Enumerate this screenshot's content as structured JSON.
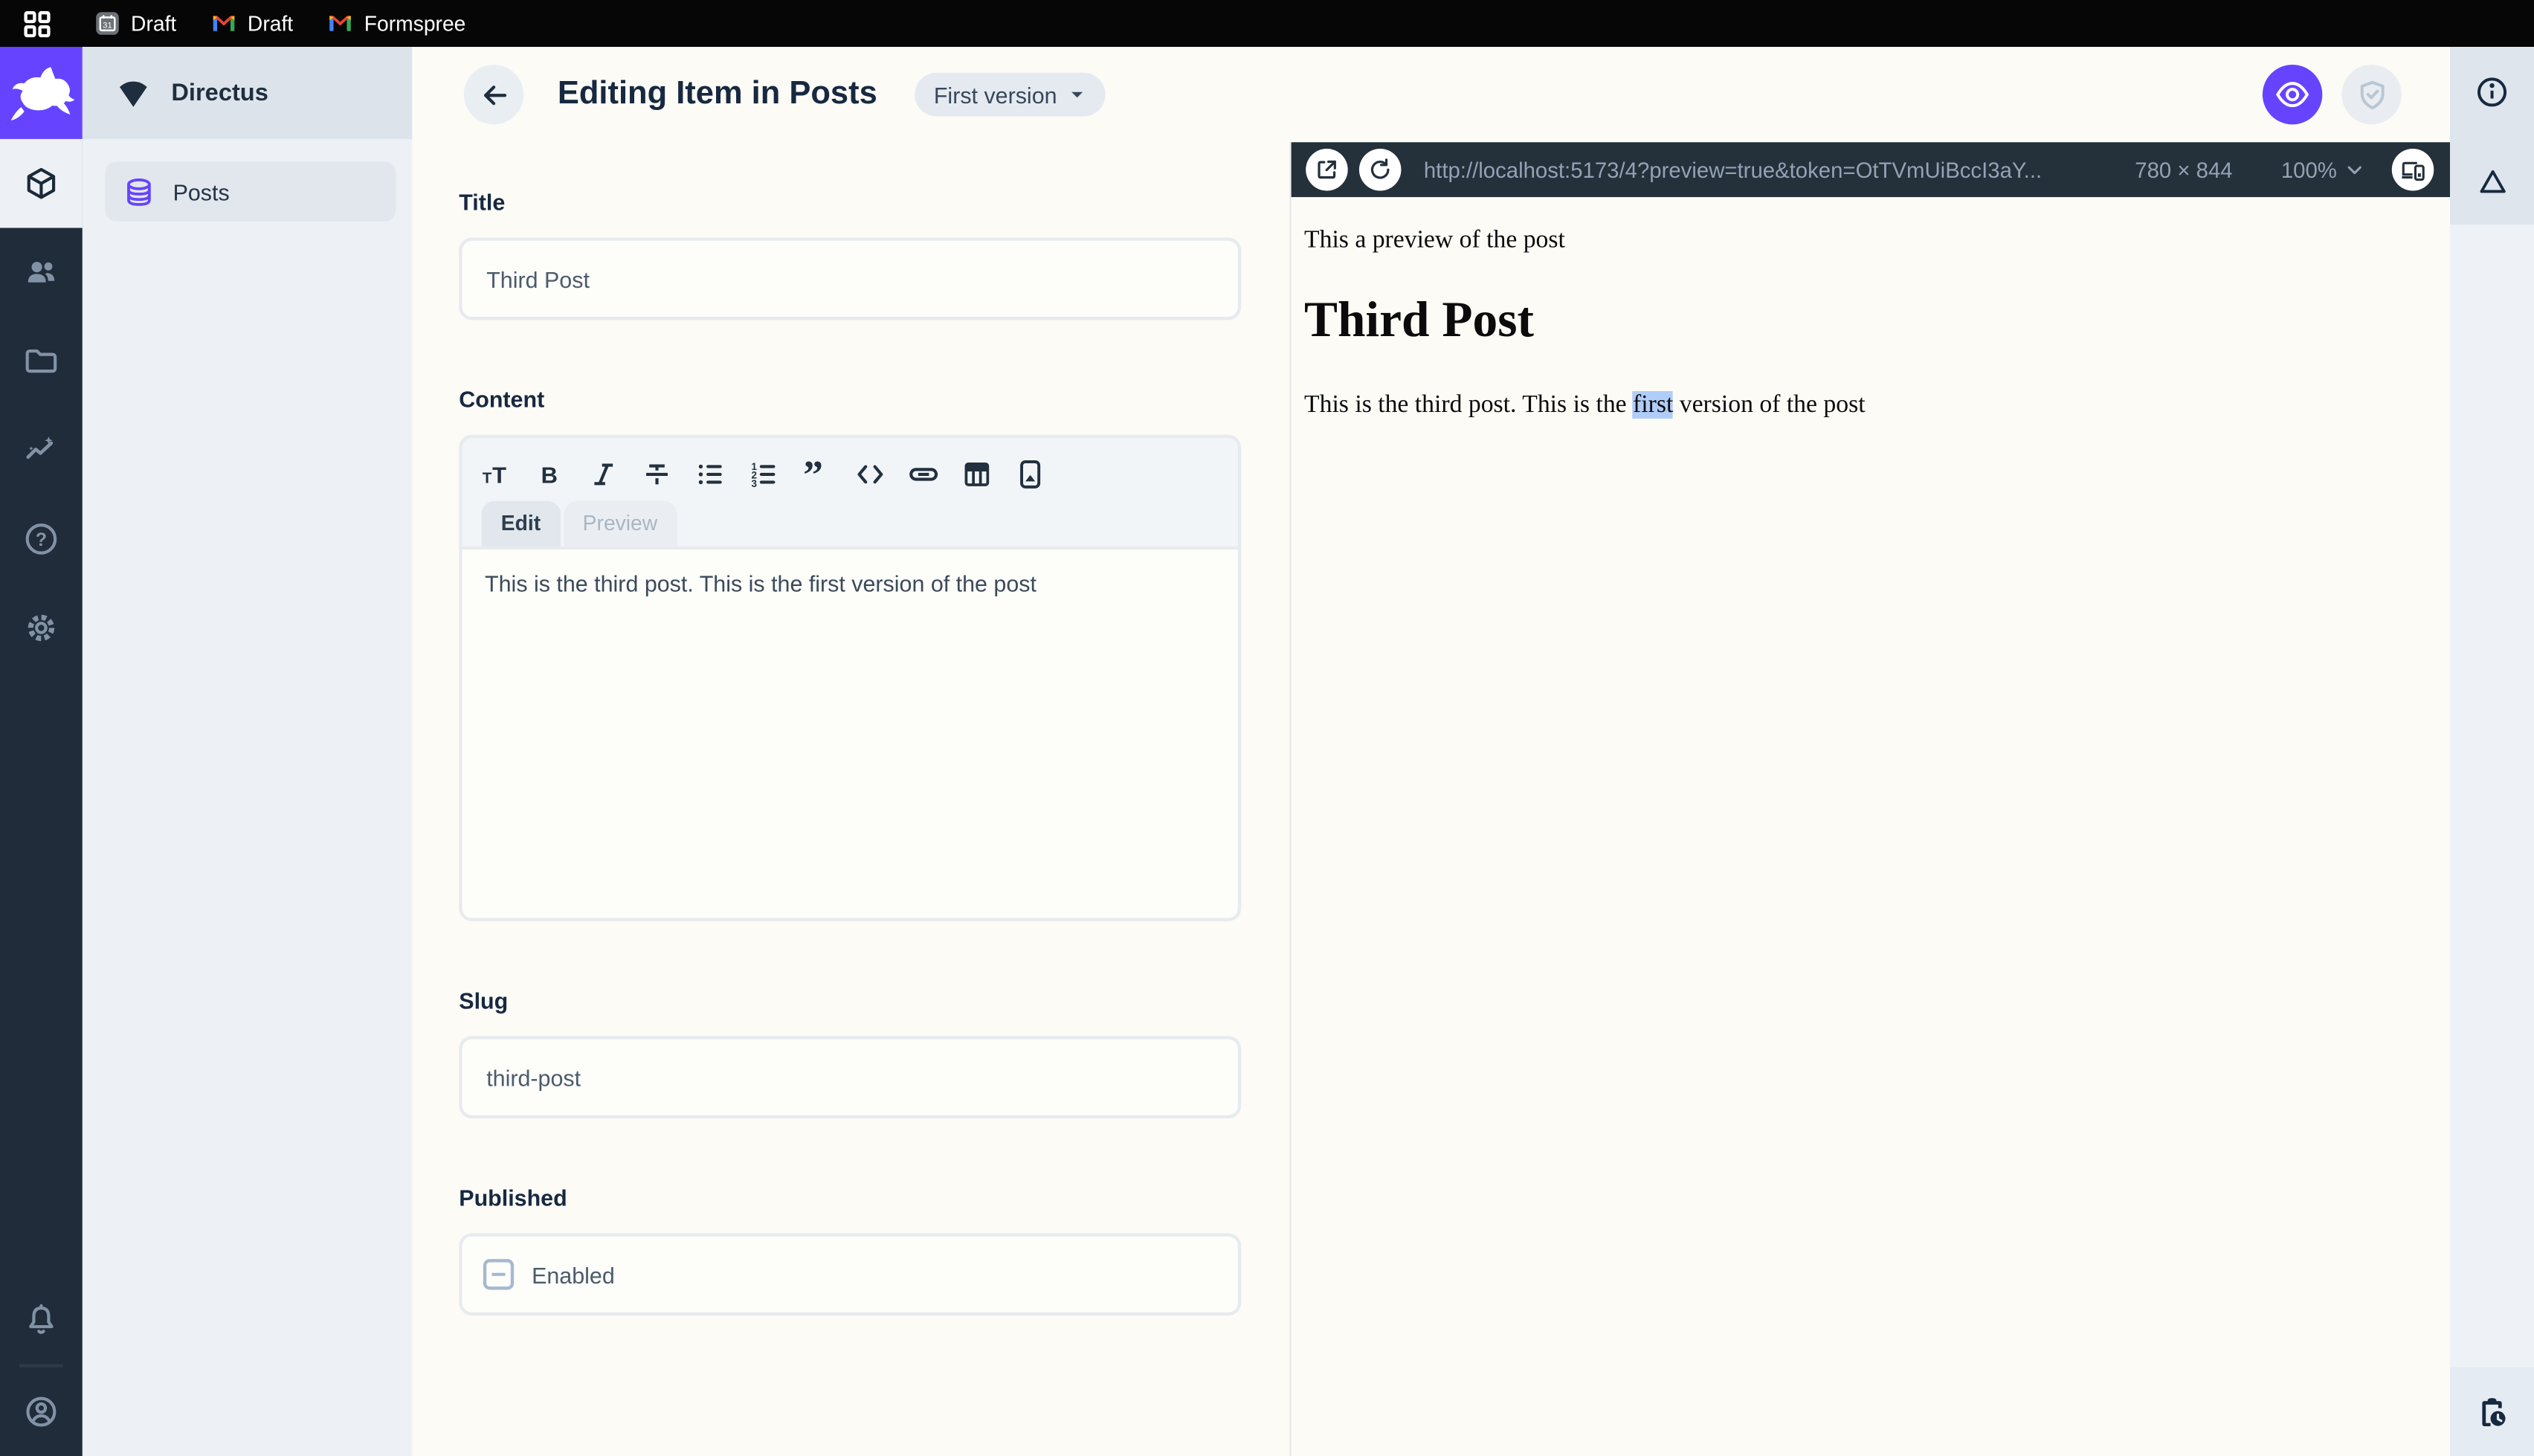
{
  "browser": {
    "window_icon": "grid-icon",
    "tabs": [
      {
        "icon": "calendar-icon",
        "label": "Draft"
      },
      {
        "icon": "gmail-icon",
        "label": "Draft"
      },
      {
        "icon": "gmail-icon",
        "label": "Formspree"
      }
    ]
  },
  "sidebar": {
    "project_name": "Directus",
    "project_icon": "fan-icon",
    "modules": [
      "content-module-icon",
      "users-module-icon",
      "files-module-icon",
      "insights-module-icon",
      "docs-module-icon",
      "settings-module-icon"
    ],
    "footer_icons": [
      "notifications-bell-icon",
      "user-avatar-icon"
    ],
    "nav_items": [
      {
        "icon": "database-icon",
        "label": "Posts",
        "active": true
      }
    ]
  },
  "header": {
    "back_icon": "arrow-left-icon",
    "title": "Editing Item in Posts",
    "version_label": "First version",
    "actions": [
      "live-preview-eye-icon",
      "accountability-shield-icon"
    ]
  },
  "form": {
    "title": {
      "label": "Title",
      "value": "Third Post"
    },
    "content": {
      "label": "Content",
      "toolbar_icons": [
        "heading-icon",
        "bold-icon",
        "italic-icon",
        "strikethrough-icon",
        "bullet-list-icon",
        "numbered-list-icon",
        "blockquote-icon",
        "code-icon",
        "link-icon",
        "table-icon",
        "image-icon"
      ],
      "tabs": [
        {
          "label": "Edit",
          "active": true
        },
        {
          "label": "Preview",
          "active": false
        }
      ],
      "value": "This is the third post. This is the first version of the post"
    },
    "slug": {
      "label": "Slug",
      "value": "third-post"
    },
    "published": {
      "label": "Published",
      "checkbox_label": "Enabled",
      "checkbox_state": "indeterminate"
    }
  },
  "preview_panel": {
    "toolbar_icons": [
      "open-external-icon",
      "refresh-icon",
      "devices-icon"
    ],
    "url": "http://localhost:5173/4?preview=true&token=OtTVmUiBccI3aY...",
    "dimensions": "780 × 844",
    "zoom_level": "100%",
    "page": {
      "intro": "This a preview of the post",
      "heading": "Third Post",
      "body_before": "This is the third post. This is the ",
      "body_highlight": "first",
      "body_after": " version of the post"
    }
  },
  "right_rail": {
    "icons": [
      "info-icon",
      "triangle-icon",
      "clipboard-clock-icon"
    ]
  },
  "colors": {
    "accent_purple": "#6644ff",
    "dark_navy": "#172940",
    "preview_bar": "#24303a",
    "selection_highlight": "#b0cdf9"
  }
}
